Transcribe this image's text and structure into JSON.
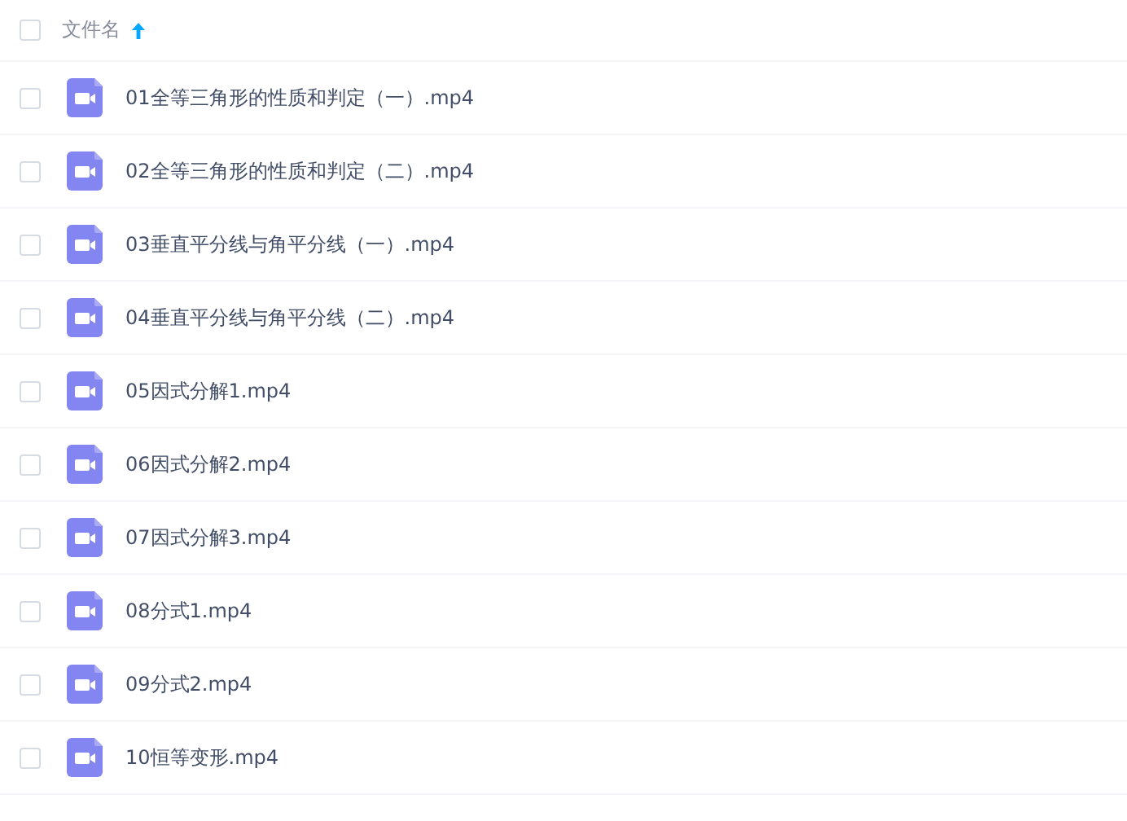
{
  "header": {
    "checked": false,
    "label": "文件名",
    "sorted_ascending": true
  },
  "files": [
    {
      "name": "01全等三角形的性质和判定（一）.mp4",
      "kind": "video",
      "checked": false
    },
    {
      "name": "02全等三角形的性质和判定（二）.mp4",
      "kind": "video",
      "checked": false
    },
    {
      "name": "03垂直平分线与角平分线（一）.mp4",
      "kind": "video",
      "checked": false
    },
    {
      "name": "04垂直平分线与角平分线（二）.mp4",
      "kind": "video",
      "checked": false
    },
    {
      "name": "05因式分解1.mp4",
      "kind": "video",
      "checked": false
    },
    {
      "name": "06因式分解2.mp4",
      "kind": "video",
      "checked": false
    },
    {
      "name": "07因式分解3.mp4",
      "kind": "video",
      "checked": false
    },
    {
      "name": "08分式1.mp4",
      "kind": "video",
      "checked": false
    },
    {
      "name": "09分式2.mp4",
      "kind": "video",
      "checked": false
    },
    {
      "name": "10恒等变形.mp4",
      "kind": "video",
      "checked": false
    }
  ]
}
